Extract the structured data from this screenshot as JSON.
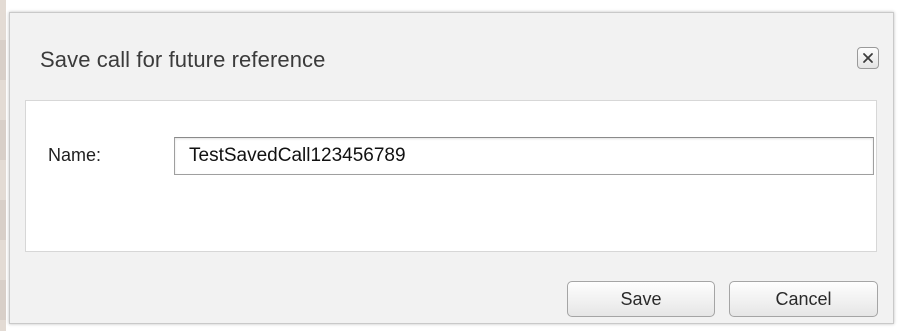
{
  "dialog": {
    "title": "Save call for future reference",
    "close_icon": "close-icon"
  },
  "form": {
    "name_label": "Name:",
    "name_value": "TestSavedCall123456789"
  },
  "footer": {
    "save_label": "Save",
    "cancel_label": "Cancel"
  }
}
